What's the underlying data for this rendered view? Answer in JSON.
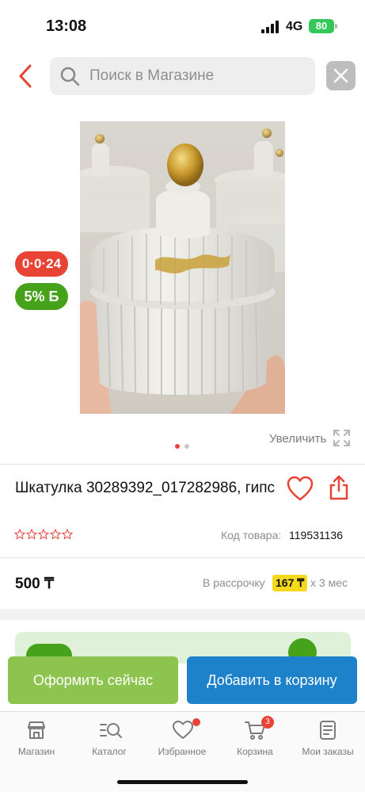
{
  "status_bar": {
    "time": "13:08",
    "network": "4G",
    "battery": "80"
  },
  "search": {
    "placeholder": "Поиск в Магазине",
    "value": ""
  },
  "badges": {
    "promo": "0·0·24",
    "bonus": "5% Б"
  },
  "gallery": {
    "zoom_label": "Увеличить",
    "image_count": 2,
    "current_image": 1
  },
  "product": {
    "title": "Шкатулка  30289392_017282986, гипс",
    "rating": 0,
    "code_label": "Код товара:",
    "code": "119531136",
    "price": "500 ₸",
    "installment_label": "В рассрочку",
    "installment_amount": "167 ₸",
    "installment_term": "х 3 мес"
  },
  "actions": {
    "checkout": "Оформить сейчас",
    "add_to_cart": "Добавить в корзину"
  },
  "tab_bar": {
    "items": [
      {
        "label": "Магазин",
        "icon": "store-icon"
      },
      {
        "label": "Каталог",
        "icon": "catalog-search-icon"
      },
      {
        "label": "Избранное",
        "icon": "heart-icon"
      },
      {
        "label": "Корзина",
        "icon": "cart-icon"
      },
      {
        "label": "Мои заказы",
        "icon": "orders-icon"
      }
    ],
    "cart_count": "3"
  },
  "colors": {
    "accent_red": "#e94335",
    "checkout_green": "#8dc44f",
    "cart_blue": "#1e82cb",
    "bonus_green": "#45a21a",
    "installment_yellow": "#f6d81d"
  }
}
